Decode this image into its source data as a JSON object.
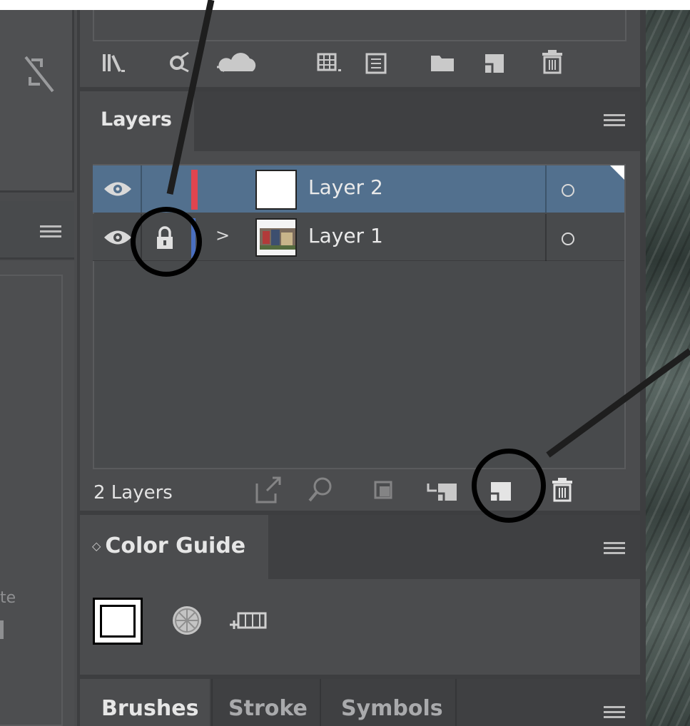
{
  "layers_panel": {
    "tab_label": "Layers",
    "rows": [
      {
        "name": "Layer 2",
        "selected": true,
        "locked": false,
        "expandable": false,
        "color": "#e0454f"
      },
      {
        "name": "Layer 1",
        "selected": false,
        "locked": true,
        "expandable": true,
        "color": "#4a6fbf"
      }
    ],
    "expand_glyph": ">",
    "footer_count": "2 Layers",
    "selection_color": "#52708e"
  },
  "color_guide": {
    "tab_label": "Color Guide",
    "collapse_glyph": "◇"
  },
  "bottom_tabs": {
    "brushes": "Brushes",
    "stroke": "Stroke",
    "symbols": "Symbols"
  },
  "left_panel": {
    "partial_text": "te"
  },
  "icons": {
    "top_toolbar": [
      "libraries-icon",
      "link-icon",
      "cloud-upload-icon",
      "grid-view-icon",
      "list-view-icon",
      "folder-icon",
      "new-item-icon",
      "trash-icon"
    ],
    "layers_footer": [
      "make-clipping-mask-icon",
      "locate-object-icon",
      "collect-in-new-layer-icon",
      "create-sublayer-icon",
      "new-layer-icon",
      "delete-layer-icon"
    ],
    "color_guide": [
      "swatch-icon",
      "color-wheel-icon",
      "save-color-group-icon"
    ]
  },
  "annotations": {
    "circles": [
      "lock-icon-highlight",
      "new-layer-icon-highlight"
    ]
  }
}
